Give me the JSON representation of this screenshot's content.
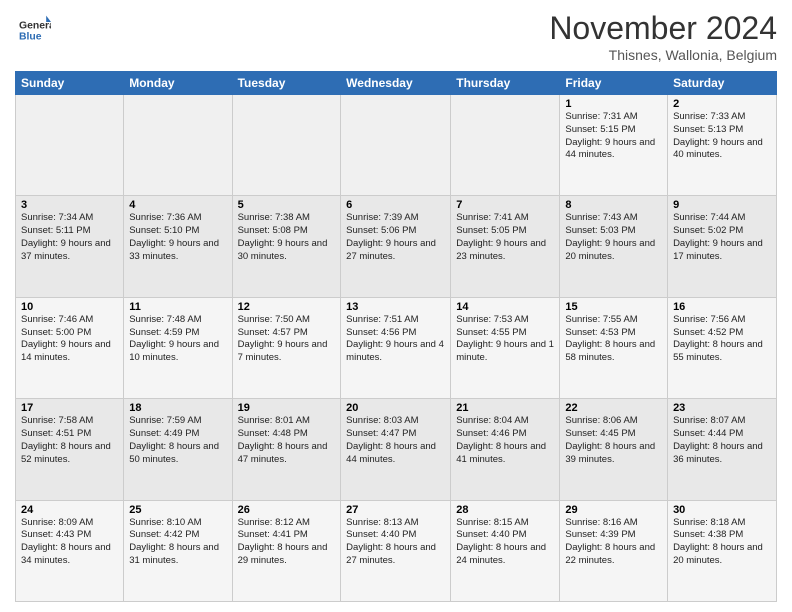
{
  "title": "November 2024",
  "location": "Thisnes, Wallonia, Belgium",
  "logo": {
    "line1": "General",
    "line2": "Blue"
  },
  "days_of_week": [
    "Sunday",
    "Monday",
    "Tuesday",
    "Wednesday",
    "Thursday",
    "Friday",
    "Saturday"
  ],
  "weeks": [
    [
      {
        "day": "",
        "info": ""
      },
      {
        "day": "",
        "info": ""
      },
      {
        "day": "",
        "info": ""
      },
      {
        "day": "",
        "info": ""
      },
      {
        "day": "",
        "info": ""
      },
      {
        "day": "1",
        "info": "Sunrise: 7:31 AM\nSunset: 5:15 PM\nDaylight: 9 hours\nand 44 minutes."
      },
      {
        "day": "2",
        "info": "Sunrise: 7:33 AM\nSunset: 5:13 PM\nDaylight: 9 hours\nand 40 minutes."
      }
    ],
    [
      {
        "day": "3",
        "info": "Sunrise: 7:34 AM\nSunset: 5:11 PM\nDaylight: 9 hours\nand 37 minutes."
      },
      {
        "day": "4",
        "info": "Sunrise: 7:36 AM\nSunset: 5:10 PM\nDaylight: 9 hours\nand 33 minutes."
      },
      {
        "day": "5",
        "info": "Sunrise: 7:38 AM\nSunset: 5:08 PM\nDaylight: 9 hours\nand 30 minutes."
      },
      {
        "day": "6",
        "info": "Sunrise: 7:39 AM\nSunset: 5:06 PM\nDaylight: 9 hours\nand 27 minutes."
      },
      {
        "day": "7",
        "info": "Sunrise: 7:41 AM\nSunset: 5:05 PM\nDaylight: 9 hours\nand 23 minutes."
      },
      {
        "day": "8",
        "info": "Sunrise: 7:43 AM\nSunset: 5:03 PM\nDaylight: 9 hours\nand 20 minutes."
      },
      {
        "day": "9",
        "info": "Sunrise: 7:44 AM\nSunset: 5:02 PM\nDaylight: 9 hours\nand 17 minutes."
      }
    ],
    [
      {
        "day": "10",
        "info": "Sunrise: 7:46 AM\nSunset: 5:00 PM\nDaylight: 9 hours\nand 14 minutes."
      },
      {
        "day": "11",
        "info": "Sunrise: 7:48 AM\nSunset: 4:59 PM\nDaylight: 9 hours\nand 10 minutes."
      },
      {
        "day": "12",
        "info": "Sunrise: 7:50 AM\nSunset: 4:57 PM\nDaylight: 9 hours\nand 7 minutes."
      },
      {
        "day": "13",
        "info": "Sunrise: 7:51 AM\nSunset: 4:56 PM\nDaylight: 9 hours\nand 4 minutes."
      },
      {
        "day": "14",
        "info": "Sunrise: 7:53 AM\nSunset: 4:55 PM\nDaylight: 9 hours\nand 1 minute."
      },
      {
        "day": "15",
        "info": "Sunrise: 7:55 AM\nSunset: 4:53 PM\nDaylight: 8 hours\nand 58 minutes."
      },
      {
        "day": "16",
        "info": "Sunrise: 7:56 AM\nSunset: 4:52 PM\nDaylight: 8 hours\nand 55 minutes."
      }
    ],
    [
      {
        "day": "17",
        "info": "Sunrise: 7:58 AM\nSunset: 4:51 PM\nDaylight: 8 hours\nand 52 minutes."
      },
      {
        "day": "18",
        "info": "Sunrise: 7:59 AM\nSunset: 4:49 PM\nDaylight: 8 hours\nand 50 minutes."
      },
      {
        "day": "19",
        "info": "Sunrise: 8:01 AM\nSunset: 4:48 PM\nDaylight: 8 hours\nand 47 minutes."
      },
      {
        "day": "20",
        "info": "Sunrise: 8:03 AM\nSunset: 4:47 PM\nDaylight: 8 hours\nand 44 minutes."
      },
      {
        "day": "21",
        "info": "Sunrise: 8:04 AM\nSunset: 4:46 PM\nDaylight: 8 hours\nand 41 minutes."
      },
      {
        "day": "22",
        "info": "Sunrise: 8:06 AM\nSunset: 4:45 PM\nDaylight: 8 hours\nand 39 minutes."
      },
      {
        "day": "23",
        "info": "Sunrise: 8:07 AM\nSunset: 4:44 PM\nDaylight: 8 hours\nand 36 minutes."
      }
    ],
    [
      {
        "day": "24",
        "info": "Sunrise: 8:09 AM\nSunset: 4:43 PM\nDaylight: 8 hours\nand 34 minutes."
      },
      {
        "day": "25",
        "info": "Sunrise: 8:10 AM\nSunset: 4:42 PM\nDaylight: 8 hours\nand 31 minutes."
      },
      {
        "day": "26",
        "info": "Sunrise: 8:12 AM\nSunset: 4:41 PM\nDaylight: 8 hours\nand 29 minutes."
      },
      {
        "day": "27",
        "info": "Sunrise: 8:13 AM\nSunset: 4:40 PM\nDaylight: 8 hours\nand 27 minutes."
      },
      {
        "day": "28",
        "info": "Sunrise: 8:15 AM\nSunset: 4:40 PM\nDaylight: 8 hours\nand 24 minutes."
      },
      {
        "day": "29",
        "info": "Sunrise: 8:16 AM\nSunset: 4:39 PM\nDaylight: 8 hours\nand 22 minutes."
      },
      {
        "day": "30",
        "info": "Sunrise: 8:18 AM\nSunset: 4:38 PM\nDaylight: 8 hours\nand 20 minutes."
      }
    ]
  ]
}
